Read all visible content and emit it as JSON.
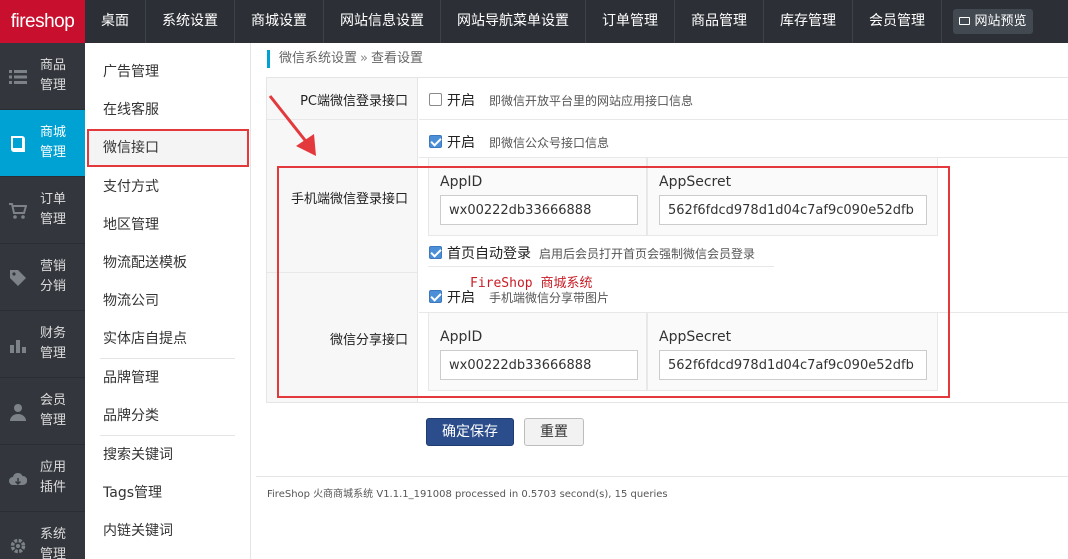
{
  "logo": "fireshop",
  "top_nav": [
    "桌面",
    "系统设置",
    "商城设置",
    "网站信息设置",
    "网站导航菜单设置",
    "订单管理",
    "商品管理",
    "库存管理",
    "会员管理"
  ],
  "preview_label": "网站预览",
  "left_menu": [
    {
      "label": "商品管理",
      "icon": "list-icon"
    },
    {
      "label": "商城管理",
      "icon": "book-icon",
      "active": true
    },
    {
      "label": "订单管理",
      "icon": "cart-icon"
    },
    {
      "label": "营销分销",
      "icon": "tag-icon"
    },
    {
      "label": "财务管理",
      "icon": "bar-chart-icon"
    },
    {
      "label": "会员管理",
      "icon": "user-icon"
    },
    {
      "label": "应用插件",
      "icon": "cloud-icon"
    },
    {
      "label": "系统管理",
      "icon": "gear-icon"
    }
  ],
  "sub_menu": [
    "广告管理",
    "在线客服",
    "微信接口",
    "支付方式",
    "地区管理",
    "物流配送模板",
    "物流公司",
    "实体店自提点",
    "品牌管理",
    "品牌分类",
    "搜索关键词",
    "Tags管理",
    "内链关键词"
  ],
  "sub_menu_active": "微信接口",
  "breadcrumb": {
    "parent": "微信系统设置",
    "sep": "»",
    "current": "查看设置"
  },
  "form": {
    "pc_login": {
      "label": "PC端微信登录接口",
      "enable_label": "开启",
      "enabled": false,
      "hint": "即微信开放平台里的网站应用接口信息"
    },
    "mobile_login": {
      "label": "手机端微信登录接口",
      "enable_label": "开启",
      "enabled": true,
      "hint": "即微信公众号接口信息",
      "appid_label": "AppID",
      "appid_value": "wx00222db33666888",
      "secret_label": "AppSecret",
      "secret_value": "562f6fdcd978d1d04c7af9c090e52dfb",
      "auto_login_label": "首页自动登录",
      "auto_login_enabled": true,
      "auto_login_hint": "启用后会员打开首页会强制微信会员登录"
    },
    "share": {
      "label": "微信分享接口",
      "enable_label": "开启",
      "enabled": true,
      "hint": "手机端微信分享带图片",
      "appid_label": "AppID",
      "appid_value": "wx00222db33666888",
      "secret_label": "AppSecret",
      "secret_value": "562f6fdcd978d1d04c7af9c090e52dfb"
    }
  },
  "watermark": "FireShop 商城系统",
  "buttons": {
    "save": "确定保存",
    "reset": "重置"
  },
  "footer": "FireShop 火商商城系统 V1.1.1_191008 processed in 0.5703 second(s), 15 queries",
  "colors": {
    "accent": "#00a2d4",
    "brand": "#c8102e",
    "highlight": "#e4393c",
    "primary_button": "#2c4d8b"
  }
}
